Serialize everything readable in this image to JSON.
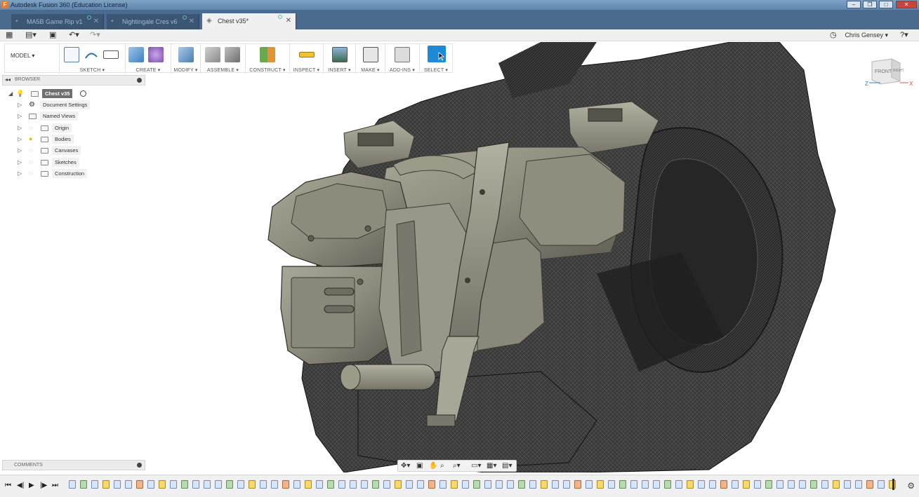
{
  "window": {
    "title": "Autodesk Fusion 360 (Education License)",
    "app_icon": "F"
  },
  "tabs": [
    {
      "label": "MA5B Game Rip v1",
      "active": false
    },
    {
      "label": "Nightingale Cres v6",
      "active": false
    },
    {
      "label": "Chest v35*",
      "active": true
    }
  ],
  "quick_access": {
    "user_name": "Chris Gensey"
  },
  "ribbon": {
    "workspace": "MODEL",
    "groups": [
      {
        "label": "SKETCH"
      },
      {
        "label": "CREATE"
      },
      {
        "label": "MODIFY"
      },
      {
        "label": "ASSEMBLE"
      },
      {
        "label": "CONSTRUCT"
      },
      {
        "label": "INSPECT"
      },
      {
        "label": "INSERT"
      },
      {
        "label": "MAKE"
      },
      {
        "label": "ADD-INS"
      },
      {
        "label": "SELECT"
      }
    ]
  },
  "browser": {
    "header": "BROWSER",
    "root": "Chest v35",
    "items": [
      {
        "label": "Document Settings"
      },
      {
        "label": "Named Views"
      },
      {
        "label": "Origin"
      },
      {
        "label": "Bodies"
      },
      {
        "label": "Canvases"
      },
      {
        "label": "Sketches"
      },
      {
        "label": "Construction"
      }
    ]
  },
  "comments": {
    "header": "COMMENTS"
  },
  "viewcube": {
    "front": "FRONT",
    "right": "RIGHT",
    "axis_z": "Z",
    "axis_x": "X"
  },
  "colors": {
    "titlebar": "#6f93b8",
    "tabstrip": "#4a6b8f",
    "select_accent": "#1e8ad6",
    "mesh_dark": "#2a2a2a",
    "solid_body": "#8b8a7c"
  }
}
